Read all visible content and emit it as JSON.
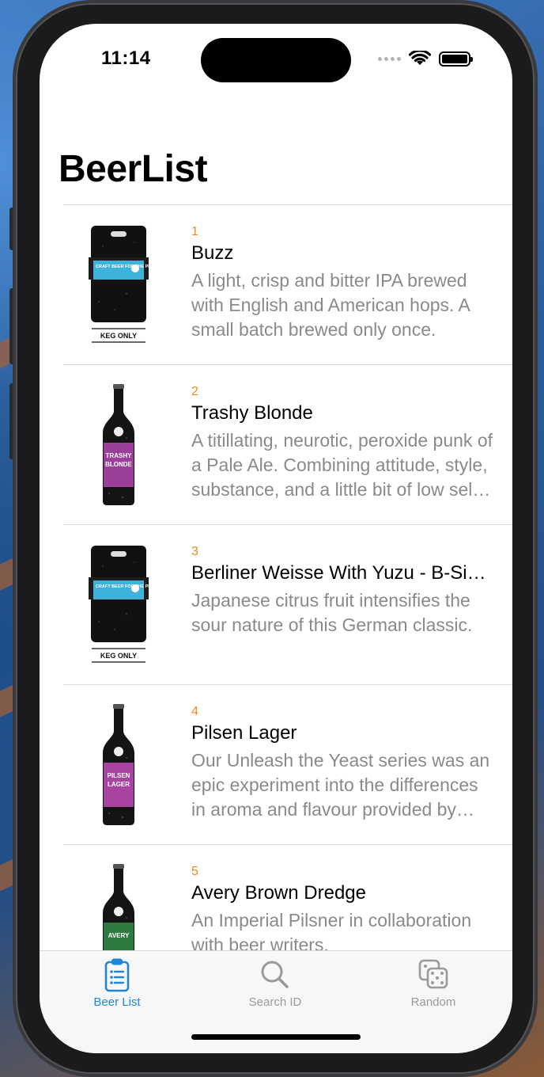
{
  "status_bar": {
    "time": "11:14"
  },
  "navigation": {
    "title": "BeerList"
  },
  "beers": [
    {
      "id": "1",
      "name": "Buzz",
      "description": "A light, crisp and bitter IPA brewed with English and American hops. A small batch brewed only once.",
      "image": "keg",
      "keg_label": "KEG ONLY",
      "label_text": "CRAFT BEER FOR THE PEOPLE"
    },
    {
      "id": "2",
      "name": "Trashy Blonde",
      "description": "A titillating, neurotic, peroxide punk of a Pale Ale. Combining attitude, style, substance, and a little bit of low self esteem.",
      "image": "bottle",
      "label_color": "#9b3f9a",
      "label_text": "TRASHY BLONDE"
    },
    {
      "id": "3",
      "name": "Berliner Weisse With Yuzu - B-Sides",
      "description": "Japanese citrus fruit intensifies the sour nature of this German classic.",
      "image": "keg",
      "keg_label": "KEG ONLY",
      "label_text": "CRAFT BEER FOR THE PEOPLE"
    },
    {
      "id": "4",
      "name": "Pilsen Lager",
      "description": "Our Unleash the Yeast series was an epic experiment into the differences in aroma and flavour provided by different yeasts.",
      "image": "bottle",
      "label_color": "#a8449f",
      "label_text": "PILSEN LAGER"
    },
    {
      "id": "5",
      "name": "Avery Brown Dredge",
      "description": "An Imperial Pilsner in collaboration with beer writers.",
      "image": "bottle",
      "label_color": "#2f7a3e",
      "label_text": "AVERY"
    }
  ],
  "tabs": [
    {
      "label": "Beer List",
      "icon": "clipboard-list-icon",
      "active": true
    },
    {
      "label": "Search ID",
      "icon": "magnifying-glass-icon",
      "active": false
    },
    {
      "label": "Random",
      "icon": "dice-icon",
      "active": false
    }
  ],
  "colors": {
    "accent": "#1f86d8",
    "number": "#f08a1c",
    "secondary_text": "#8a8a8e"
  }
}
